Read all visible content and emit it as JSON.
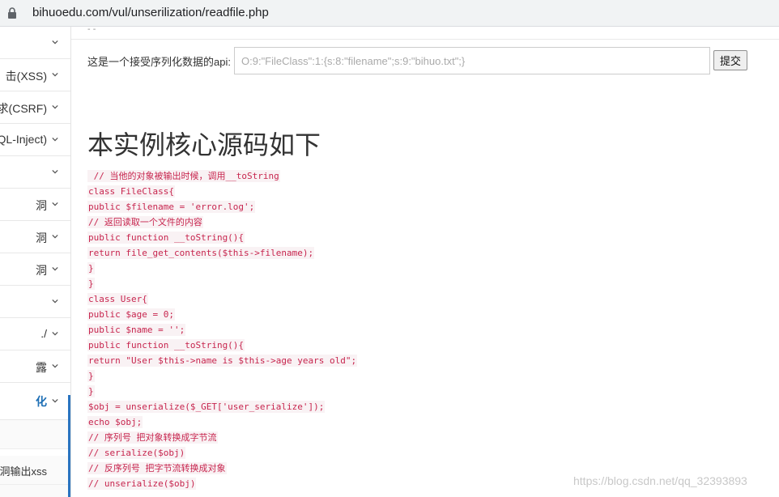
{
  "browser": {
    "url": "bihuoedu.com/vul/unserilization/readfile.php"
  },
  "sidebar": {
    "items": [
      {
        "label": "",
        "icon": "chevron-down-icon"
      },
      {
        "label": "击(XSS)",
        "icon": "chevron-down-icon"
      },
      {
        "label": "求(CSRF)",
        "icon": "chevron-down-icon"
      },
      {
        "label": "QL-Inject)",
        "icon": "chevron-down-icon"
      },
      {
        "label": "",
        "icon": "chevron-down-icon"
      },
      {
        "label": "洞",
        "icon": "chevron-down-icon"
      },
      {
        "label": "洞",
        "icon": "chevron-down-icon"
      },
      {
        "label": "洞",
        "icon": "chevron-down-icon"
      },
      {
        "label": "",
        "icon": "chevron-down-icon"
      },
      {
        "label": "./",
        "icon": "chevron-down-icon"
      },
      {
        "label": "露",
        "icon": "chevron-down-icon"
      },
      {
        "label": "化",
        "icon": "chevron-down-icon",
        "active": true
      }
    ],
    "subitems": [
      {
        "label": ""
      },
      {
        "label": "洞输出xss"
      },
      {
        "label": ""
      }
    ],
    "active_color": "#1e6fb5"
  },
  "form": {
    "label": "这是一个接受序列化数据的api:",
    "placeholder": "O:9:\"FileClass\":1:{s:8:\"filename\";s:9:\"bihuo.txt\";}",
    "submit_label": "提交"
  },
  "main": {
    "heading": "本实例核心源码如下",
    "code_lines": [
      " // 当他的对象被输出时候，调用__toString",
      "class FileClass{",
      "public $filename = 'error.log';",
      "// 返回读取一个文件的内容",
      "public function __toString(){",
      "return file_get_contents($this->filename);",
      "}",
      "}",
      "class User{",
      "public $age = 0;",
      "public $name = '';",
      "public function __toString(){",
      "return \"User $this->name is $this->age years old\";",
      "}",
      "}",
      "$obj = unserialize($_GET['user_serialize']);",
      "echo $obj;",
      "// 序列号 把对象转换成字节流",
      "// serialize($obj)",
      "// 反序列号 把字节流转换成对象",
      "// unserialize($obj)"
    ],
    "code_color": "#c7254e"
  },
  "watermark": "https://blog.csdn.net/qq_32393893"
}
